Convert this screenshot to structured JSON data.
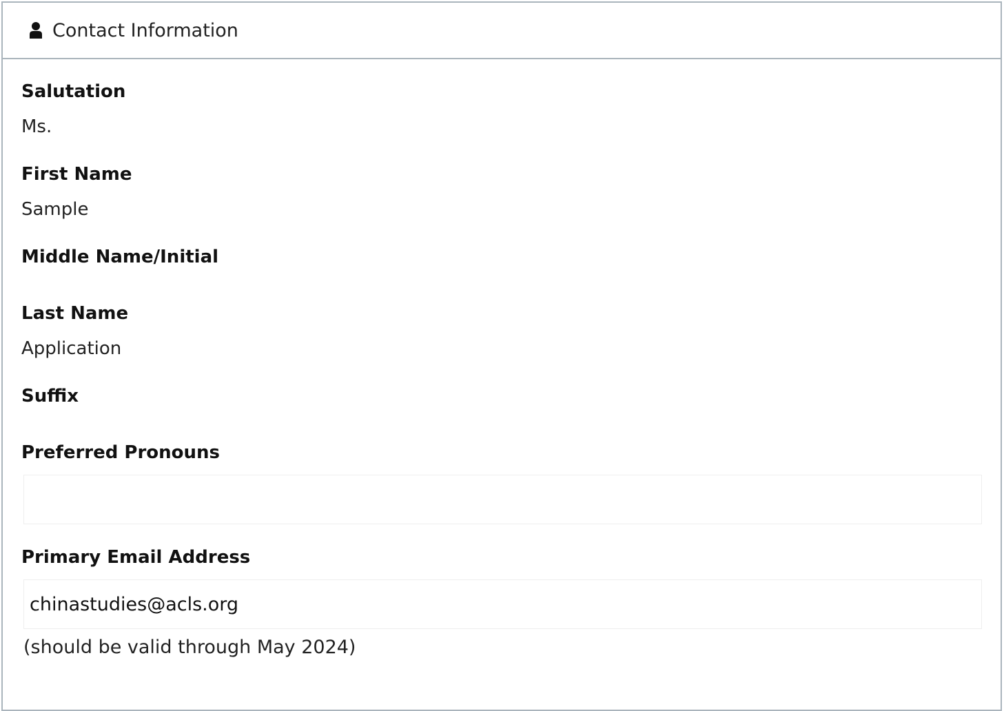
{
  "header": {
    "icon": "user-icon",
    "title": "Contact Information"
  },
  "fields": {
    "salutation": {
      "label": "Salutation",
      "value": "Ms."
    },
    "first_name": {
      "label": "First Name",
      "value": "Sample"
    },
    "middle_name": {
      "label": "Middle Name/Initial",
      "value": ""
    },
    "last_name": {
      "label": "Last Name",
      "value": "Application"
    },
    "suffix": {
      "label": "Suffix",
      "value": ""
    },
    "pronouns": {
      "label": "Preferred Pronouns",
      "value": ""
    },
    "email": {
      "label": "Primary Email Address",
      "value": "chinastudies@acls.org",
      "help": "(should be valid through May 2024)"
    }
  }
}
